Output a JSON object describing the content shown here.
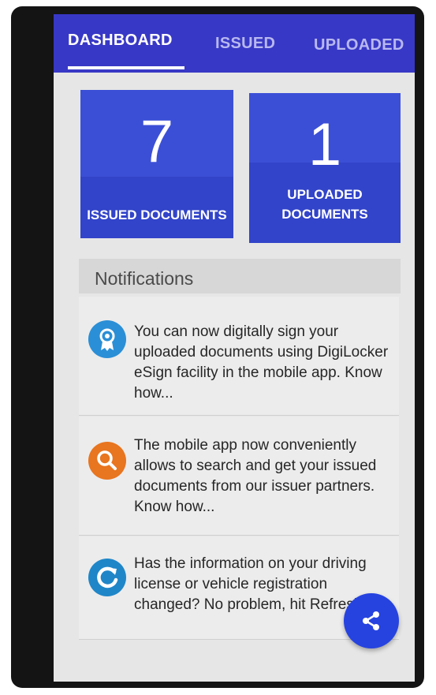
{
  "tabs": [
    {
      "label": "DASHBOARD",
      "active": true
    },
    {
      "label": "ISSUED",
      "active": false
    },
    {
      "label": "UPLOADED",
      "active": false
    }
  ],
  "tiles": {
    "issued": {
      "count": "7",
      "label": "ISSUED DOCUMENTS"
    },
    "uploaded": {
      "count": "1",
      "label_line1": "UPLOADED",
      "label_line2": "DOCUMENTS"
    }
  },
  "notifications": {
    "header": "Notifications",
    "items": [
      {
        "icon": "certificate-icon",
        "text": "You can now digitally sign your uploaded documents using DigiLocker eSign facility in the mobile app. Know how..."
      },
      {
        "icon": "search-icon",
        "text": "The mobile app now conveniently allows to search and get your issued documents from our issuer partners. Know how..."
      },
      {
        "icon": "refresh-icon",
        "text": "Has the information on your driving license or vehicle registration changed? No problem, hit Refresh"
      }
    ]
  },
  "fab": {
    "icon": "share-icon"
  },
  "colors": {
    "accent": "#3838c6",
    "tile": "#3b4fd6",
    "fab": "#2643e0",
    "icon_blue": "#2a8fd6",
    "icon_orange": "#e8751f"
  }
}
